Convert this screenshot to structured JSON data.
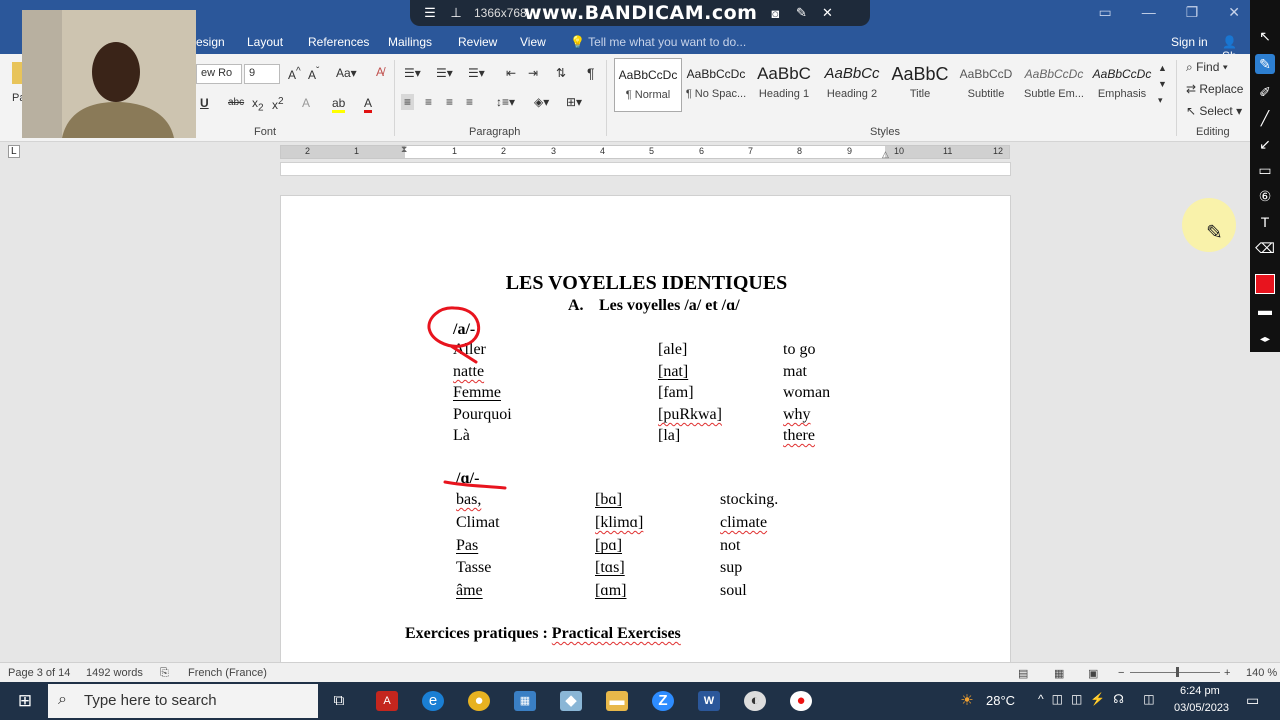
{
  "recording": {
    "resolution": "1366x768",
    "brand": "www.BANDICAM.com"
  },
  "ribbon_tabs": [
    "esign",
    "Layout",
    "References",
    "Mailings",
    "Review",
    "View"
  ],
  "tell_me": "Tell me what you want to do...",
  "account": {
    "sign_in": "Sign in",
    "share": "Sh"
  },
  "ribbon": {
    "paste_label": "Pa",
    "font_name": "ew Ro",
    "font_size": "9",
    "groups": {
      "font": "Font",
      "paragraph": "Paragraph",
      "styles": "Styles",
      "editing": "Editing"
    },
    "styles": [
      {
        "sample": "AaBbCcDc",
        "name": "¶ Normal"
      },
      {
        "sample": "AaBbCcDc",
        "name": "¶ No Spac..."
      },
      {
        "sample": "AaBbC",
        "name": "Heading 1"
      },
      {
        "sample": "AaBbCc",
        "name": "Heading 2"
      },
      {
        "sample": "AaBbC",
        "name": "Title"
      },
      {
        "sample": "AaBbCcD",
        "name": "Subtitle"
      },
      {
        "sample": "AaBbCcDc",
        "name": "Subtle Em..."
      },
      {
        "sample": "AaBbCcDc",
        "name": "Emphasis"
      }
    ],
    "editing": {
      "find": "Find",
      "replace": "Replace",
      "select": "Select"
    }
  },
  "ruler_numbers": [
    "2",
    "1",
    "1",
    "2",
    "3",
    "4",
    "5",
    "6",
    "7",
    "8",
    "9",
    "10",
    "11",
    "12"
  ],
  "document": {
    "title": "LES VOYELLES IDENTIQUES",
    "subtitle_marker": "A.",
    "subtitle": "Les voyelles /a/ et /ɑ/",
    "section_a_header": "/a/-",
    "section_a": [
      {
        "word": "Aller",
        "ipa": "[ale]",
        "gloss": "to go"
      },
      {
        "word": "natte",
        "ipa": "[nat]",
        "gloss": "mat"
      },
      {
        "word": "Femme",
        "ipa": "[fam]",
        "gloss": "woman"
      },
      {
        "word": "Pourquoi",
        "ipa": "[puRkwa]",
        "gloss": "why"
      },
      {
        "word": "Là",
        "ipa": "[la]",
        "gloss": "there"
      }
    ],
    "section_b_header": "/ɑ/-",
    "section_b": [
      {
        "word": "bas,",
        "ipa": "[bɑ]",
        "gloss": "stocking."
      },
      {
        "word": "Climat",
        "ipa": "[klimɑ]",
        "gloss": "climate"
      },
      {
        "word": "Pas",
        "ipa": "[pɑ]",
        "gloss": "not"
      },
      {
        "word": "Tasse",
        "ipa": "[tɑs]",
        "gloss": "sup"
      },
      {
        "word": "âme",
        "ipa": "[ɑm]",
        "gloss": "soul"
      }
    ],
    "exercise_label": "Exercices pratiques : ",
    "exercise_title": "Practical Exercises"
  },
  "status": {
    "page": "Page 3 of 14",
    "words": "1492 words",
    "language": "French (France)",
    "zoom": "140 %"
  },
  "taskbar": {
    "search_placeholder": "Type here to search",
    "temperature": "28°C",
    "time": "6:24 pm",
    "date": "03/05/2023"
  },
  "colors": {
    "word_blue": "#2b579a",
    "annotation_red": "#e8141e",
    "taskbar": "#1f3147"
  }
}
